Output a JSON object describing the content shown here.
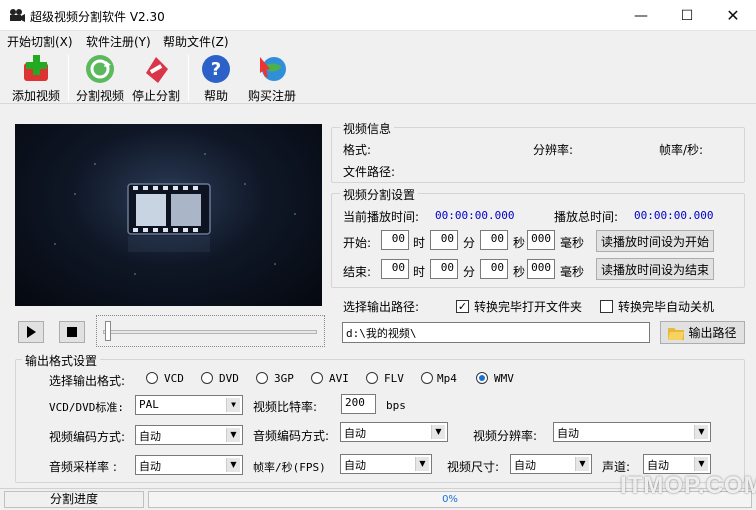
{
  "window": {
    "title": "超级视频分割软件 V2.30"
  },
  "menu": {
    "items": [
      "开始切割(X)",
      "软件注册(Y)",
      "帮助文件(Z)"
    ]
  },
  "toolbar": {
    "add": "添加视频",
    "split": "分割视频",
    "stop": "停止分割",
    "help": "帮助",
    "buy": "购买注册"
  },
  "info": {
    "group_title": "视频信息",
    "format_label": "格式:",
    "resolution_label": "分辨率:",
    "fps_label": "帧率/秒:",
    "path_label": "文件路径:"
  },
  "split": {
    "group_title": "视频分割设置",
    "current_label": "当前播放时间:",
    "current_value": "00:00:00.000",
    "total_label": "播放总时间:",
    "total_value": "00:00:00.000",
    "start_label": "开始:",
    "end_label": "结束:",
    "unit_h": "时",
    "unit_m": "分",
    "unit_s": "秒",
    "unit_ms": "毫秒",
    "start": {
      "h": "00",
      "m": "00",
      "s": "00",
      "ms": "000"
    },
    "end": {
      "h": "00",
      "m": "00",
      "s": "00",
      "ms": "000"
    },
    "set_start_btn": "读播放时间设为开始",
    "set_end_btn": "读播放时间设为结束"
  },
  "output": {
    "path_label": "选择输出路径:",
    "open_folder_label": "转换完毕打开文件夹",
    "open_folder_checked": true,
    "shutdown_label": "转换完毕自动关机",
    "shutdown_checked": false,
    "path_value": "d:\\我的视频\\",
    "path_btn": "输出路径"
  },
  "format": {
    "group_title": "输出格式设置",
    "select_label": "选择输出格式:",
    "options": [
      "VCD",
      "DVD",
      "3GP",
      "AVI",
      "FLV",
      "Mp4",
      "WMV"
    ],
    "selected": "WMV",
    "standard_label": "VCD/DVD标准:",
    "standard_value": "PAL",
    "bitrate_label": "视频比特率:",
    "bitrate_value": "200",
    "bitrate_unit": "bps",
    "vcodec_label": "视频编码方式:",
    "vcodec_value": "自动",
    "acodec_label": "音频编码方式:",
    "acodec_value": "自动",
    "vres_label": "视频分辨率:",
    "vres_value": "自动",
    "asample_label": "音频采样率 :",
    "asample_value": "自动",
    "fps_label": "帧率/秒(FPS)",
    "fps_value": "自动",
    "size_label": "视频尺寸:",
    "size_value": "自动",
    "channel_label": "声道:",
    "channel_value": "自动"
  },
  "status": {
    "label": "分割进度",
    "progress_text": "0%",
    "progress": 0
  },
  "watermark": "ITMOP.COM",
  "colors": {
    "accent": "#1a6fd6",
    "time_text": "#0000c8"
  }
}
